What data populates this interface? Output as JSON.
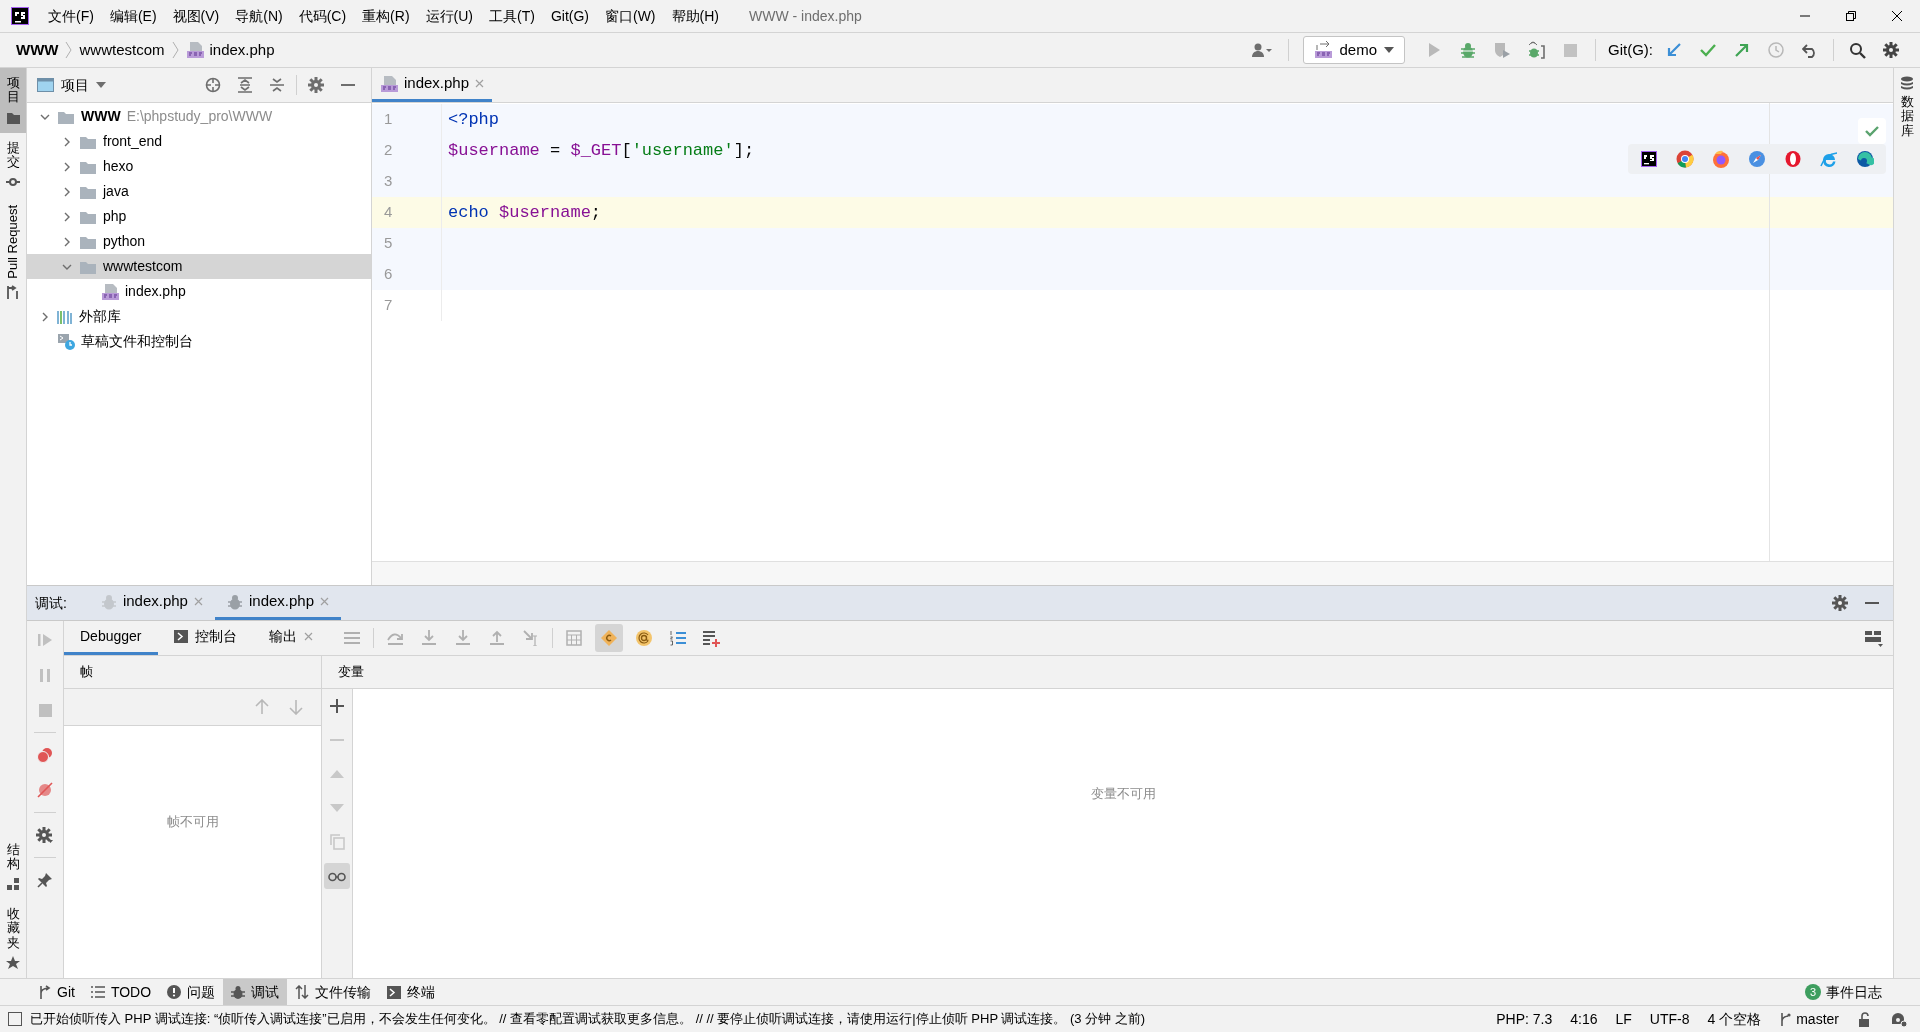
{
  "window_title": "WWW - index.php",
  "menu": [
    "文件(F)",
    "编辑(E)",
    "视图(V)",
    "导航(N)",
    "代码(C)",
    "重构(R)",
    "运行(U)",
    "工具(T)",
    "Git(G)",
    "窗口(W)",
    "帮助(H)"
  ],
  "breadcrumbs": [
    {
      "label": "WWW",
      "kind": "root"
    },
    {
      "label": "wwwtestcom",
      "kind": "folder"
    },
    {
      "label": "index.php",
      "kind": "php"
    }
  ],
  "run_config": "demo",
  "git_label": "Git(G):",
  "left_strip": [
    {
      "label": "项目",
      "kind": "cjk",
      "selected": true
    },
    {
      "label": "提交",
      "kind": "cjk",
      "selected": false
    },
    {
      "label": "Pull Request",
      "kind": "latin",
      "selected": false
    }
  ],
  "left_strip_bottom": [
    {
      "label": "结构",
      "selected": false
    },
    {
      "label": "收藏夹",
      "selected": false
    }
  ],
  "right_strip": [
    "数据库"
  ],
  "project_panel": {
    "title": "项目",
    "tree": [
      {
        "label": "WWW",
        "path": "E:\\phpstudy_pro\\WWW",
        "kind": "root",
        "expanded": true,
        "selected": false,
        "children": [
          {
            "label": "front_end",
            "kind": "folder",
            "expanded": false,
            "selected": false
          },
          {
            "label": "hexo",
            "kind": "folder",
            "expanded": false,
            "selected": false
          },
          {
            "label": "java",
            "kind": "folder",
            "expanded": false,
            "selected": false
          },
          {
            "label": "php",
            "kind": "folder",
            "expanded": false,
            "selected": false
          },
          {
            "label": "python",
            "kind": "folder",
            "expanded": false,
            "selected": false
          },
          {
            "label": "wwwtestcom",
            "kind": "folder",
            "expanded": true,
            "selected": true,
            "children": [
              {
                "label": "index.php",
                "kind": "php",
                "selected": false
              }
            ]
          }
        ]
      },
      {
        "label": "外部库",
        "kind": "library",
        "expanded": false,
        "selected": false
      },
      {
        "label": "草稿文件和控制台",
        "kind": "scratch",
        "selected": false
      }
    ]
  },
  "editor": {
    "tabs": [
      {
        "label": "index.php",
        "selected": true
      }
    ],
    "lines": [
      {
        "number": "1",
        "selected": false,
        "tokens": [
          {
            "text": "<?php",
            "kind": "keyword"
          }
        ]
      },
      {
        "number": "2",
        "selected": false,
        "tokens": [
          {
            "text": "$username",
            "kind": "variable"
          },
          {
            "text": " = ",
            "kind": "plain"
          },
          {
            "text": "$_GET",
            "kind": "variable"
          },
          {
            "text": "[",
            "kind": "plain"
          },
          {
            "text": "'username'",
            "kind": "string"
          },
          {
            "text": "];",
            "kind": "plain"
          }
        ]
      },
      {
        "number": "3",
        "selected": false
      },
      {
        "number": "4",
        "selected": true,
        "tokens": [
          {
            "text": "echo ",
            "kind": "keyword"
          },
          {
            "text": "$username",
            "kind": "variable"
          },
          {
            "text": ";",
            "kind": "plain"
          }
        ]
      },
      {
        "number": "5",
        "selected": false
      },
      {
        "number": "6",
        "selected": false
      },
      {
        "number": "7",
        "selected": false
      }
    ]
  },
  "debug": {
    "label": "调试:",
    "sessions": [
      {
        "label": "index.php",
        "selected": false
      },
      {
        "label": "index.php",
        "selected": true
      }
    ],
    "tabs": [
      {
        "label": "Debugger",
        "kind": "plain",
        "selected": true
      },
      {
        "label": "控制台",
        "kind": "console",
        "selected": false
      },
      {
        "label": "输出",
        "kind": "closable",
        "selected": false
      }
    ],
    "frames_header": "帧",
    "frames_empty": "帧不可用",
    "variables_header": "变量",
    "variables_empty": "变量不可用"
  },
  "tool_windows": [
    {
      "label": "Git",
      "kind": "git",
      "selected": false
    },
    {
      "label": "TODO",
      "kind": "todo",
      "selected": false
    },
    {
      "label": "问题",
      "kind": "problems",
      "selected": false
    },
    {
      "label": "调试",
      "kind": "debug",
      "selected": true
    },
    {
      "label": "文件传输",
      "kind": "transfer",
      "selected": false
    },
    {
      "label": "终端",
      "kind": "terminal",
      "selected": false
    }
  ],
  "event_log": {
    "count": "3",
    "label": "事件日志"
  },
  "status": {
    "message": "已开始侦听传入 PHP 调试连接: “侦听传入调试连接”已启用，不会发生任何变化。 // 查看零配置调试获取更多信息。 // // 要停止侦听调试连接，请使用运行|停止侦听 PHP 调试连接。 (3 分钟 之前)",
    "items": [
      "PHP: 7.3",
      "4:16",
      "LF",
      "UTF-8",
      "4 个空格"
    ],
    "branch": "master"
  }
}
